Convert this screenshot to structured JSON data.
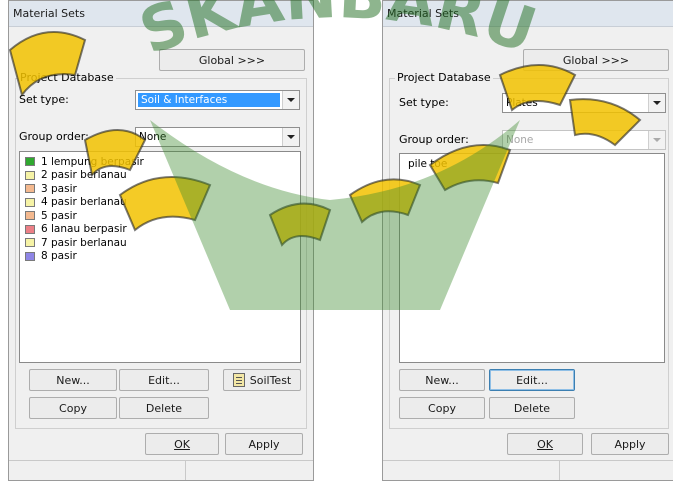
{
  "left": {
    "title": "Material Sets",
    "global_button": "Global >>>",
    "group_label": "Project Database",
    "set_type_label": "Set type:",
    "set_type_value": "Soil & Interfaces",
    "group_order_label": "Group order:",
    "group_order_value": "None",
    "items": [
      {
        "label": "1 lempung berpasir",
        "color": "#2fa82f"
      },
      {
        "label": "2 pasir berlanau",
        "color": "#f6f3a6"
      },
      {
        "label": "3 pasir",
        "color": "#f4b98f"
      },
      {
        "label": "4 pasir berlanau",
        "color": "#f6f3a6"
      },
      {
        "label": "5 pasir",
        "color": "#f4b98f"
      },
      {
        "label": "6 lanau berpasir",
        "color": "#ec7f86"
      },
      {
        "label": "7 pasir berlanau",
        "color": "#f6f3a6"
      },
      {
        "label": "8 pasir",
        "color": "#8f86e6"
      }
    ],
    "new_button": "New...",
    "edit_button": "Edit...",
    "soiltest_button": "SoilTest",
    "copy_button": "Copy",
    "delete_button": "Delete",
    "ok_button": "OK",
    "apply_button": "Apply"
  },
  "right": {
    "title": "Material Sets",
    "global_button": "Global >>>",
    "group_label": "Project Database",
    "set_type_label": "Set type:",
    "set_type_value": "Plates",
    "group_order_label": "Group order:",
    "group_order_value": "None",
    "items": [
      {
        "label": "pile toe"
      }
    ],
    "new_button": "New...",
    "edit_button": "Edit...",
    "copy_button": "Copy",
    "delete_button": "Delete",
    "ok_button": "OK",
    "apply_button": "Apply"
  },
  "watermark": {
    "text": "SKANBARU",
    "color": "#f2c200"
  }
}
